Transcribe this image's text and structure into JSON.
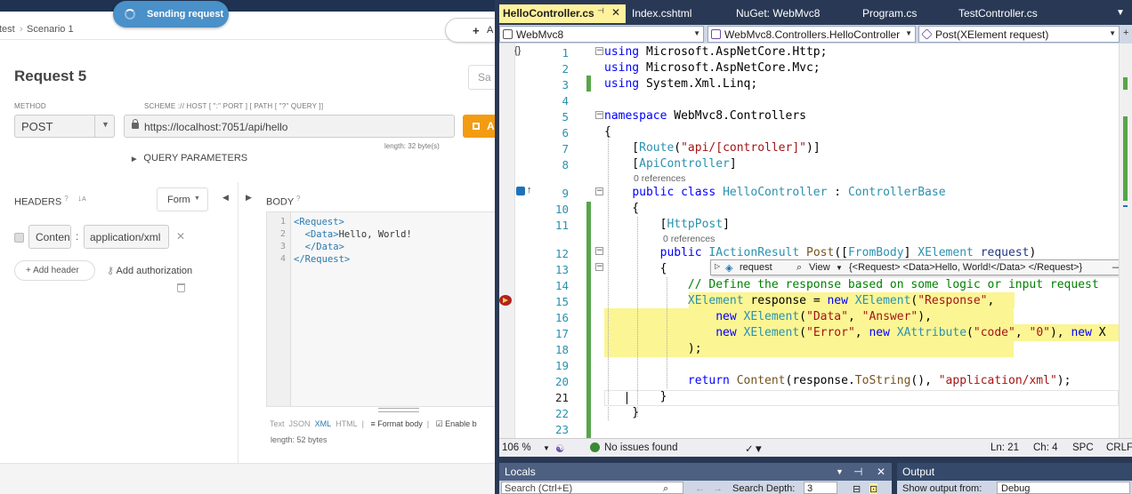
{
  "client": {
    "breadcrumb": [
      "test",
      "Scenario 1"
    ],
    "toast": "Sending request",
    "new_button": "+",
    "new_button_tail": "A",
    "request_title": "Request 5",
    "search_stub": "Sa",
    "method_label": "METHOD",
    "method_value": "POST",
    "url_label": "SCHEME :// HOST [ \":\" PORT ] [ PATH [ \"?\" QUERY ]]",
    "url_value": "https://localhost:7051/api/hello",
    "send_label": "A",
    "url_length": "length: 32 byte(s)",
    "query_params": "QUERY PARAMETERS",
    "headers_label": "HEADERS",
    "form_button": "Form",
    "header_key": "Content-Type",
    "header_value": "application/xml",
    "add_header": "+ Add header",
    "add_authorization": "Add authorization",
    "body_label": "BODY",
    "body_lines": [
      {
        "n": "1",
        "a": "<",
        "tag": "Request",
        "b": ">",
        "rest": ""
      },
      {
        "n": "2",
        "a": "  <",
        "tag": "Data",
        "b": ">",
        "rest": "Hello, World!"
      },
      {
        "n": "3",
        "a": "  </",
        "tag": "Data",
        "b": ">",
        "rest": ""
      },
      {
        "n": "4",
        "a": "</",
        "tag": "Request",
        "b": ">",
        "rest": ""
      }
    ],
    "format_options": [
      "Text",
      "JSON",
      "XML",
      "HTML"
    ],
    "format_body": "Format body",
    "enable_label": "Enable b",
    "body_length": "length: 52 bytes"
  },
  "vs": {
    "tabs": [
      {
        "label": "HelloController.cs",
        "active": true
      },
      {
        "label": "Index.cshtml",
        "active": false
      },
      {
        "label": "NuGet: WebMvc8",
        "active": false
      },
      {
        "label": "Program.cs",
        "active": false
      },
      {
        "label": "TestController.cs",
        "active": false
      }
    ],
    "nav": {
      "project": "WebMvc8",
      "class": "WebMvc8.Controllers.HelloController",
      "member": "Post(XElement request)"
    },
    "code_refs": [
      "0 references",
      "0 references"
    ],
    "datatip": {
      "name": "request",
      "view": "View",
      "value": "{<Request>  <Data>Hello, World!</Data> </Request>}"
    },
    "status": {
      "zoom": "106 %",
      "issues": "No issues found",
      "ln": "Ln: 21",
      "ch": "Ch: 4",
      "ins": "SPC",
      "eol": "CRLF"
    },
    "panels": {
      "locals": "Locals",
      "output": "Output",
      "search_placeholder": "Search (Ctrl+E)",
      "search_depth": "Search Depth:",
      "depth_value": "3",
      "show_output": "Show output from:",
      "output_source": "Debug"
    },
    "colors": {
      "accent": "#fff29d",
      "frame": "#293955",
      "highlight": "#fbf594",
      "change_bar": "#58a54a"
    }
  }
}
